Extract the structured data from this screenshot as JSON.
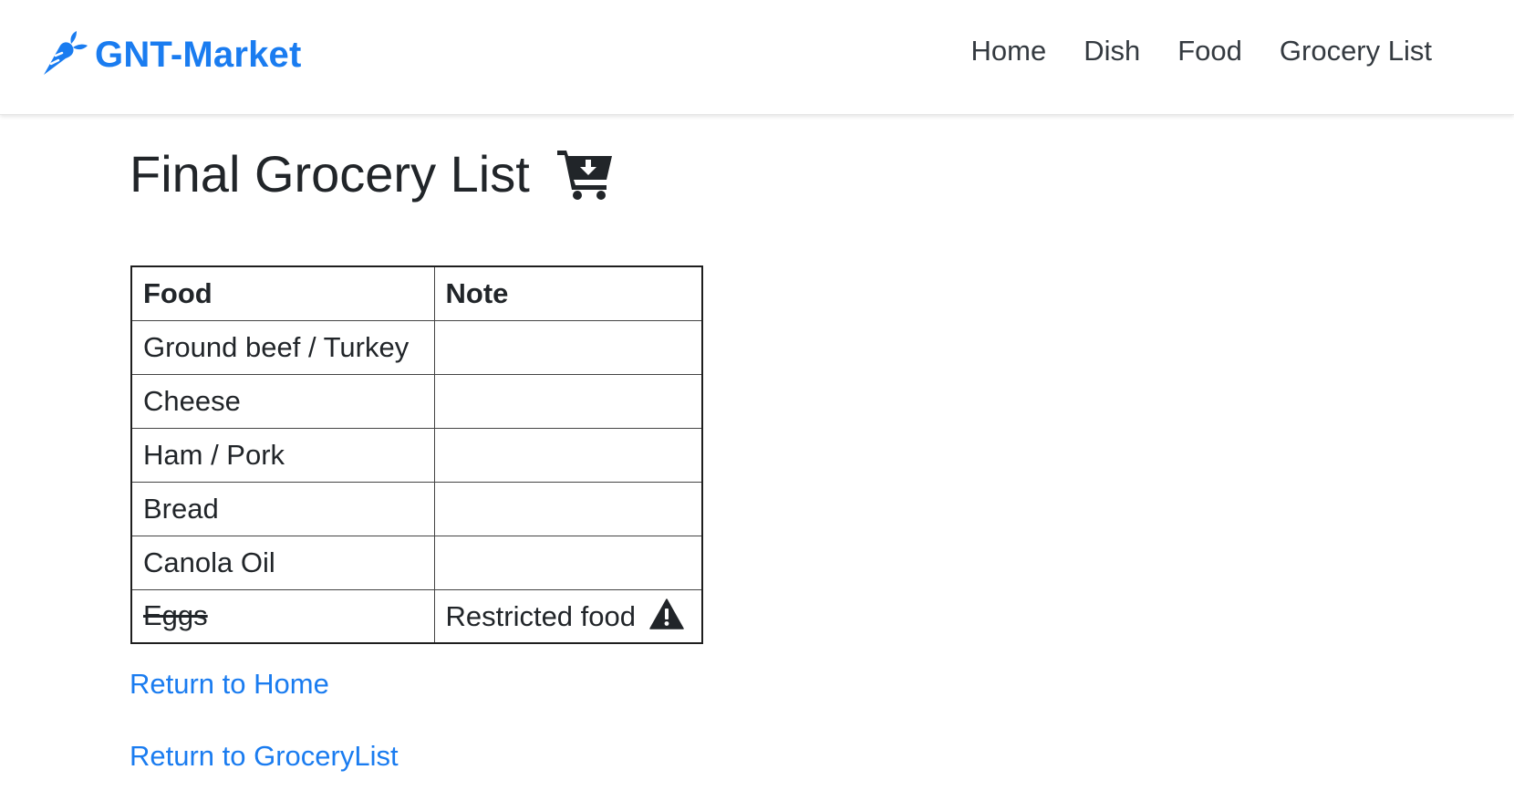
{
  "navbar": {
    "brand": "GNT-Market",
    "brand_color": "#1a7cf0",
    "logo_icon": "carrot-icon",
    "links": [
      "Home",
      "Dish",
      "Food",
      "Grocery List"
    ]
  },
  "page": {
    "title": "Final Grocery List",
    "title_icon": "cart-download-icon"
  },
  "table": {
    "headers": [
      "Food",
      "Note"
    ],
    "rows": [
      {
        "food": "Ground beef / Turkey",
        "note": "",
        "restricted": false
      },
      {
        "food": "Cheese",
        "note": "",
        "restricted": false
      },
      {
        "food": "Ham / Pork",
        "note": "",
        "restricted": false
      },
      {
        "food": "Bread",
        "note": "",
        "restricted": false
      },
      {
        "food": "Canola Oil",
        "note": "",
        "restricted": false
      },
      {
        "food": "Eggs",
        "note": "Restricted food",
        "restricted": true,
        "note_icon": "warning-icon"
      }
    ]
  },
  "links": {
    "return_home": "Return to Home",
    "return_grocery": "Return to GroceryList"
  }
}
